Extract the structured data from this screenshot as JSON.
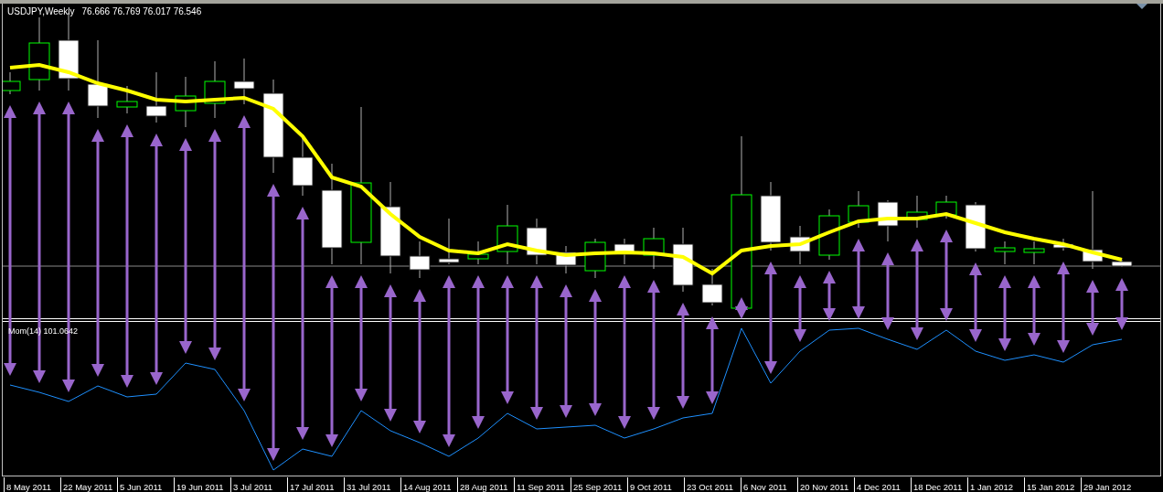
{
  "chart": {
    "symbol": "USDJPY,Weekly",
    "ohlc": "76.666 76.769 76.017 76.546"
  },
  "indicator": {
    "label": "Mom(14) 101.0642"
  },
  "time_axis": [
    "8 May 2011",
    "22 May 2011",
    "5 Jun 2011",
    "19 Jun 2011",
    "3 Jul 2011",
    "17 Jul 2011",
    "31 Jul 2011",
    "14 Aug 2011",
    "28 Aug 2011",
    "11 Sep 2011",
    "25 Sep 2011",
    "9 Oct 2011",
    "23 Oct 2011",
    "6 Nov 2011",
    "20 Nov 2011",
    "4 Dec 2011",
    "18 Dec 2011",
    "1 Jan 2012",
    "15 Jan 2012",
    "29 Jan 2012"
  ]
}
